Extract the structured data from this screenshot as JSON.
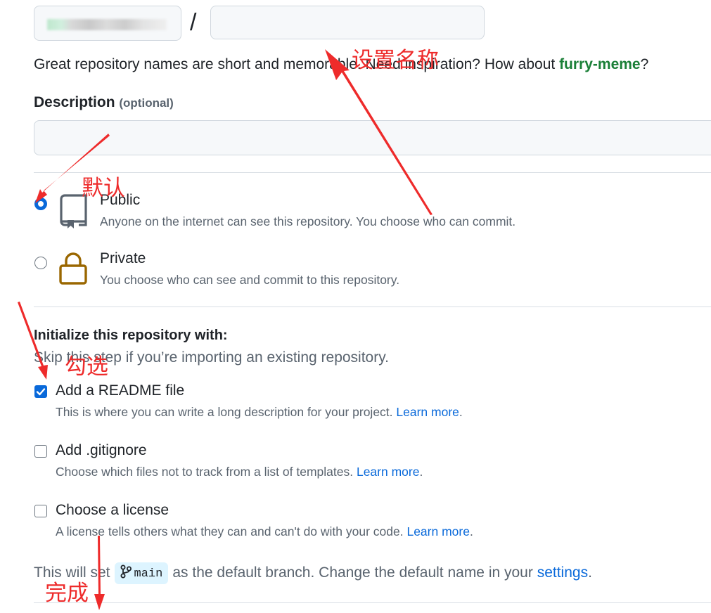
{
  "repo": {
    "separator": "/",
    "name_value": "",
    "name_placeholder": "",
    "hint_prefix": "Great repository names are short and memorable. Need inspiration? How about ",
    "hint_suggestion": "furry-meme",
    "hint_suffix": "?"
  },
  "description": {
    "label": "Description",
    "optional": "(optional)",
    "value": "",
    "placeholder": ""
  },
  "visibility": {
    "public": {
      "title": "Public",
      "subtitle": "Anyone on the internet can see this repository. You choose who can commit.",
      "selected": true
    },
    "private": {
      "title": "Private",
      "subtitle": "You choose who can see and commit to this repository.",
      "selected": false
    }
  },
  "init": {
    "title": "Initialize this repository with:",
    "subtitle": "Skip this step if you’re importing an existing repository.",
    "readme": {
      "title": "Add a README file",
      "subtitle": "This is where you can write a long description for your project. ",
      "link": "Learn more",
      "tail": ".",
      "checked": true
    },
    "gitignore": {
      "title": "Add .gitignore",
      "subtitle": "Choose which files not to track from a list of templates. ",
      "link": "Learn more",
      "tail": ".",
      "checked": false
    },
    "license": {
      "title": "Choose a license",
      "subtitle": "A license tells others what they can and can't do with your code. ",
      "link": "Learn more",
      "tail": ".",
      "checked": false
    }
  },
  "branch": {
    "prefix": "This will set",
    "name": "main",
    "middle": "as the default branch. Change the default name in your ",
    "link": "settings",
    "tail": "."
  },
  "annotations": {
    "set_name": "设置名称",
    "default": "默认",
    "check": "勾选",
    "done": "完成"
  },
  "colors": {
    "accent": "#0969da",
    "suggestion": "#1a7f37",
    "annotation": "#ee2b2b",
    "lock": "#9a6700"
  }
}
